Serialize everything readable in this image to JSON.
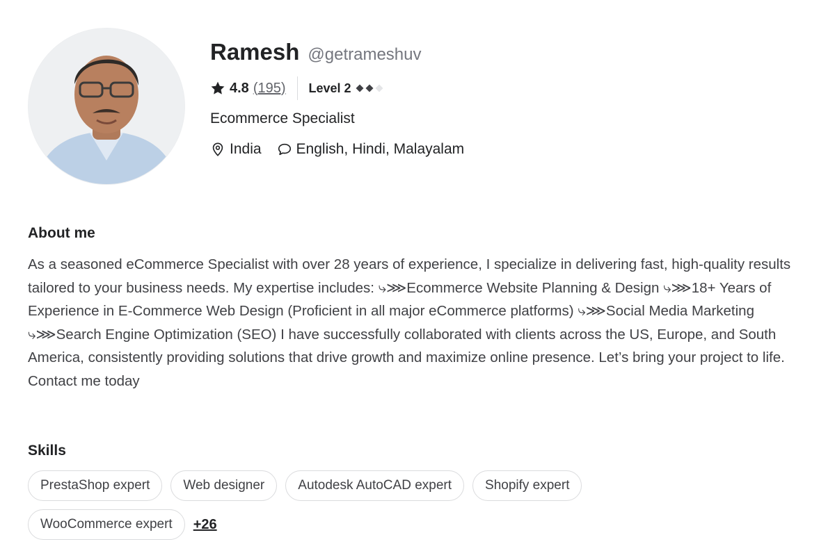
{
  "profile": {
    "name": "Ramesh",
    "username": "@getrameshuv",
    "rating": "4.8",
    "rating_count": "(195)",
    "level": "Level 2",
    "level_filled": 2,
    "level_total": 3,
    "title": "Ecommerce Specialist",
    "country": "India",
    "languages": "English, Hindi, Malayalam"
  },
  "icons": {
    "star": "star-icon",
    "location": "location-pin-icon",
    "languages": "speech-bubble-icon",
    "level": "diamond-icon"
  },
  "about": {
    "heading": "About me",
    "text": "As a seasoned eCommerce Specialist with over 28 years of experience, I specialize in delivering fast, high-quality results tailored to your business needs. My expertise includes:  ⤷⋙Ecommerce Website Planning & Design  ⤷⋙18+ Years of Experience in E-Commerce Web Design (Proficient in all major eCommerce platforms)  ⤷⋙Social Media Marketing  ⤷⋙Search Engine Optimization (SEO) I have successfully collaborated with clients across the US, Europe, and South America, consistently providing solutions that drive growth and maximize online presence. Let’s bring your project to life. Contact me today"
  },
  "skills": {
    "heading": "Skills",
    "items": [
      "PrestaShop expert",
      "Web designer",
      "Autodesk AutoCAD expert",
      "Shopify expert",
      "WooCommerce expert"
    ],
    "more": "+26"
  },
  "colors": {
    "text": "#222325",
    "muted": "#74767e",
    "border": "#dadbdd"
  }
}
